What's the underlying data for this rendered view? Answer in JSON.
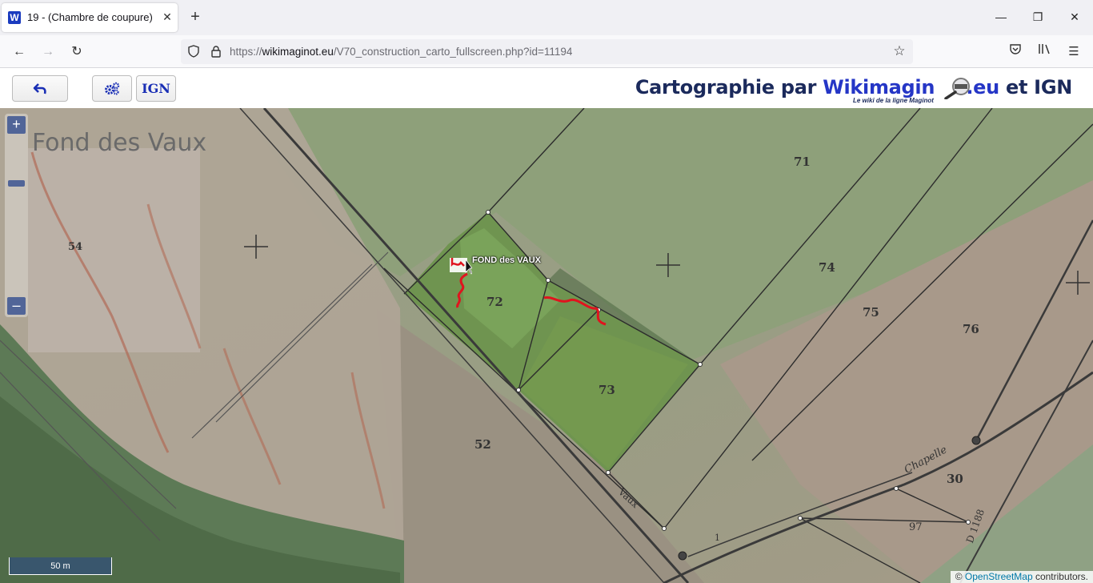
{
  "browser": {
    "tab_title": "19 - (Chambre de coupure)",
    "favicon_letter": "W",
    "url_prefix": "https://",
    "url_host": "wikimaginot.eu",
    "url_path": "/V70_construction_carto_fullscreen.php?id=11194"
  },
  "header": {
    "ign_label": "IGN",
    "title_prefix": "Cartographie par ",
    "title_brand_a": "Wikimagin",
    "title_brand_b": "t.eu",
    "title_suffix": " et IGN",
    "subtitle": "Le wiki de la ligne Maginot"
  },
  "map": {
    "place_label": "FOND des VAUX",
    "toponym_fond": "Fond des Vaux",
    "toponym_vaux": "Vaux",
    "toponym_chapelle": "Chapelle",
    "road_label": "D 1188",
    "parcels": [
      "71",
      "74",
      "75",
      "76",
      "72",
      "73",
      "52",
      "30",
      "97",
      "54",
      "1"
    ],
    "scale_label": "50 m",
    "zoom_in": "+",
    "zoom_out": "–",
    "attribution_prefix": "© ",
    "attribution_link": "OpenStreetMap",
    "attribution_suffix": " contributors."
  },
  "colors": {
    "brand_blue": "#2536c6",
    "marker_trace": "#e0141e"
  }
}
